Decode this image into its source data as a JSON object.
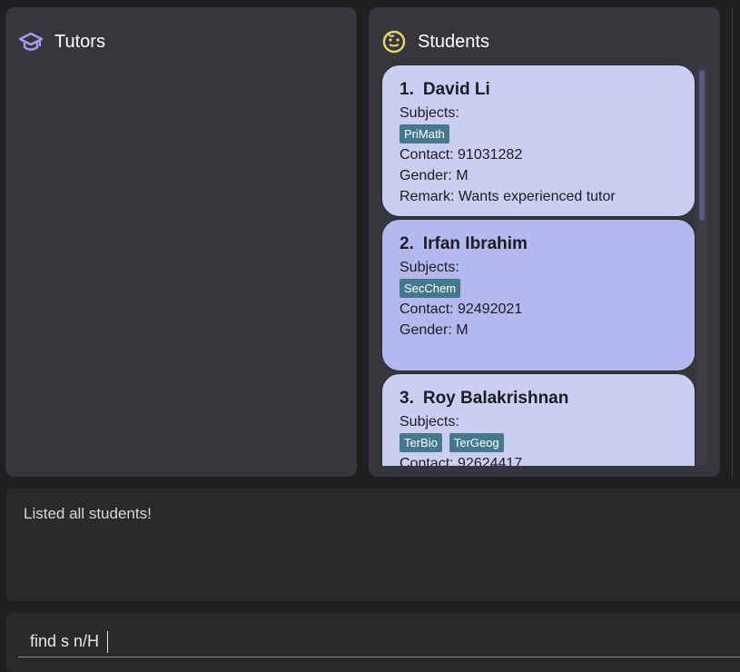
{
  "tutors_panel": {
    "title": "Tutors",
    "icon": "graduation-cap-icon",
    "icon_color": "#a99be8"
  },
  "students_panel": {
    "title": "Students",
    "icon": "smiley-face-icon",
    "icon_color": "#e6d66b",
    "students": [
      {
        "index": "1.",
        "name": "David Li",
        "subjects_label": "Subjects:",
        "subjects": [
          "PriMath"
        ],
        "contact": "Contact: 91031282",
        "gender": "Gender: M",
        "remark": "Remark: Wants experienced tutor",
        "bg": "#cbcdf3"
      },
      {
        "index": "2.",
        "name": "Irfan Ibrahim",
        "subjects_label": "Subjects:",
        "subjects": [
          "SecChem"
        ],
        "contact": "Contact: 92492021",
        "gender": "Gender: M",
        "remark": "",
        "bg": "#b3b9ee"
      },
      {
        "index": "3.",
        "name": "Roy Balakrishnan",
        "subjects_label": "Subjects:",
        "subjects": [
          "TerBio",
          "TerGeog"
        ],
        "contact": "Contact: 92624417",
        "gender": "",
        "remark": "",
        "bg": "#cbcdf3"
      }
    ]
  },
  "result": {
    "message": "Listed all students!"
  },
  "command": {
    "value": "find s n/H"
  },
  "colors": {
    "tag_bg": "#44798b",
    "panel_bg": "#36373c",
    "app_bg": "#1f1f21"
  }
}
